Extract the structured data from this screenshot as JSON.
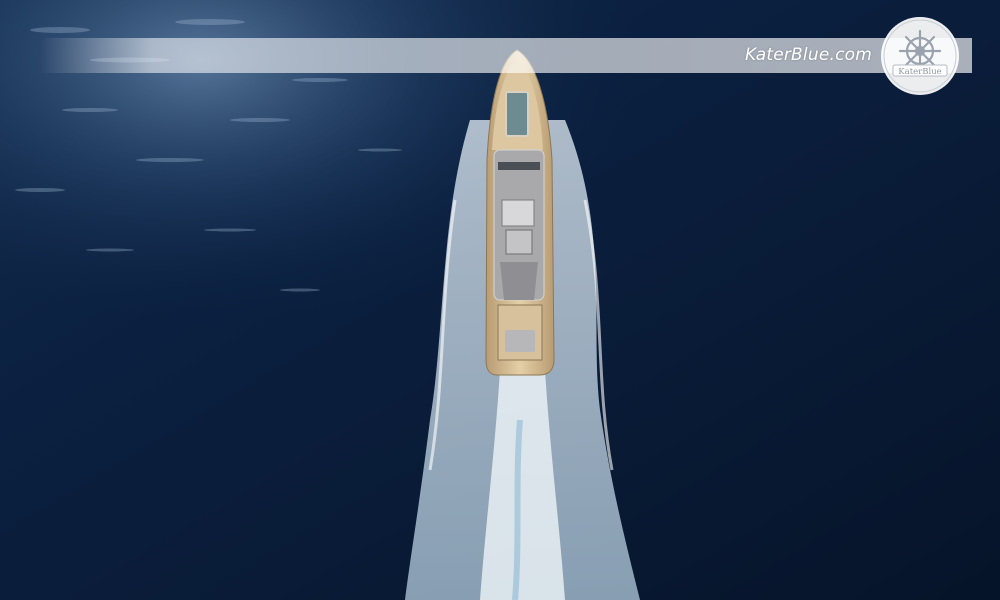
{
  "watermark": {
    "site_text": "KaterBlue.com",
    "logo_text": "KaterBlue",
    "logo_icon": "ship-wheel-icon"
  },
  "colors": {
    "sea_deep": "#061429",
    "sea_mid": "#0d2748",
    "sea_glint": "#5f7ea3",
    "wake": "#e8f1f8",
    "hull": "#c9b08a",
    "deck": "#e7dcc8",
    "superstructure": "#a9a9ab",
    "banner": "#ffffff"
  }
}
